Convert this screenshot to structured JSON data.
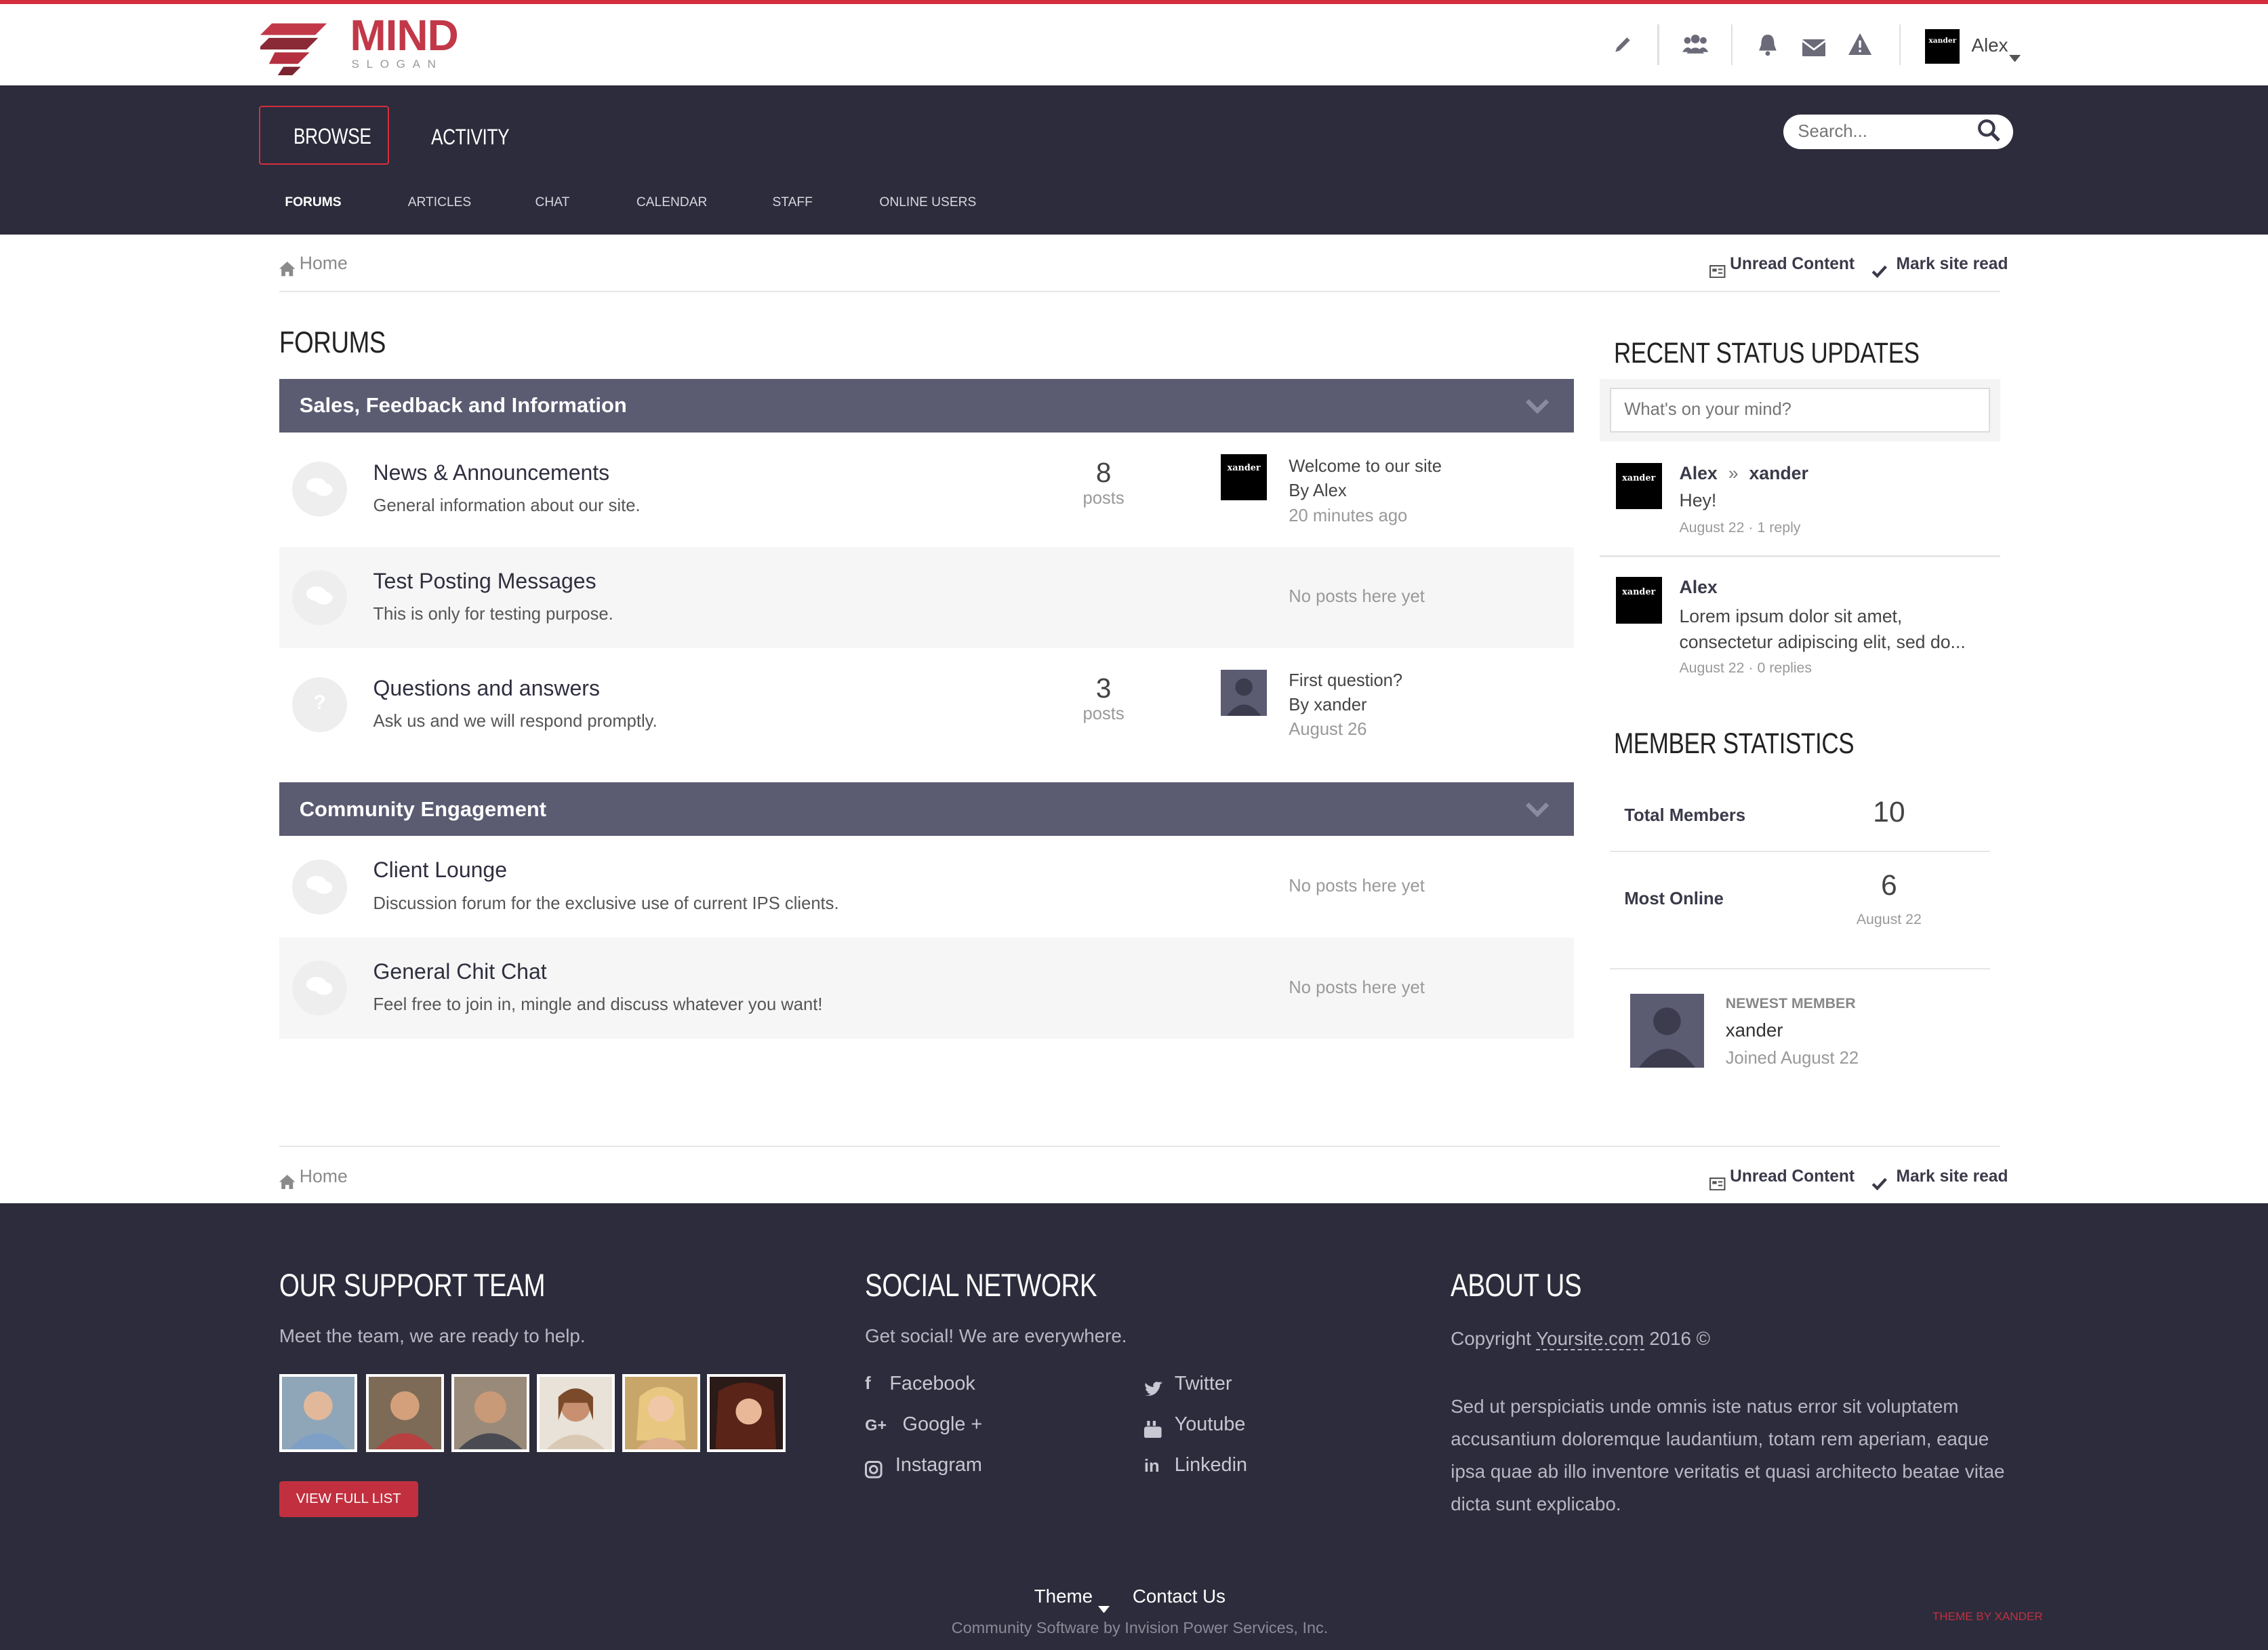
{
  "brand": {
    "name": "MIND",
    "slogan": "SLOGAN"
  },
  "user": {
    "name": "Alex"
  },
  "nav": {
    "primary": [
      {
        "label": "BROWSE"
      },
      {
        "label": "ACTIVITY"
      }
    ],
    "secondary": [
      {
        "label": "FORUMS"
      },
      {
        "label": "ARTICLES"
      },
      {
        "label": "CHAT"
      },
      {
        "label": "CALENDAR"
      },
      {
        "label": "STAFF"
      },
      {
        "label": "ONLINE USERS"
      }
    ]
  },
  "search": {
    "placeholder": "Search..."
  },
  "breadcrumb": {
    "home": "Home",
    "unread": "Unread Content",
    "mark_read": "Mark site read"
  },
  "forums": {
    "title": "FORUMS",
    "categories": [
      {
        "title": "Sales, Feedback and Information",
        "forums": [
          {
            "name": "News & Announcements",
            "desc": "General information about our site.",
            "count": "8",
            "count_label": "posts",
            "last_title": "Welcome to our site",
            "last_by": "By Alex",
            "last_time": "20 minutes ago"
          },
          {
            "name": "Test Posting Messages",
            "desc": "This is only for testing purpose.",
            "empty": "No posts here yet"
          },
          {
            "name": "Questions and answers",
            "desc": "Ask us and we will respond promptly.",
            "count": "3",
            "count_label": "posts",
            "last_title": "First question?",
            "last_by": "By xander",
            "last_time": "August 26"
          }
        ]
      },
      {
        "title": "Community Engagement",
        "forums": [
          {
            "name": "Client Lounge",
            "desc": "Discussion forum for the exclusive use of current IPS clients.",
            "empty": "No posts here yet"
          },
          {
            "name": "General Chit Chat",
            "desc": "Feel free to join in, mingle and discuss whatever you want!",
            "empty": "No posts here yet"
          }
        ]
      }
    ]
  },
  "status": {
    "title": "RECENT STATUS UPDATES",
    "placeholder": "What's on your mind?",
    "items": [
      {
        "author": "Alex",
        "sep": "»",
        "target": "xander",
        "text": "Hey!",
        "meta": "August 22 · 1 reply"
      },
      {
        "author": "Alex",
        "text": "Lorem ipsum dolor sit amet, consectetur adipiscing elit, sed do...",
        "meta": "August 22 · 0 replies"
      }
    ]
  },
  "stats": {
    "title": "MEMBER STATISTICS",
    "total_label": "Total Members",
    "total_value": "10",
    "online_label": "Most Online",
    "online_value": "6",
    "online_date": "August 22",
    "newest_label": "NEWEST MEMBER",
    "newest_name": "xander",
    "newest_joined": "Joined August 22"
  },
  "avatar_text": "xander",
  "footer": {
    "support": {
      "title": "OUR SUPPORT TEAM",
      "text": "Meet the team, we are ready to help.",
      "button": "VIEW FULL LIST"
    },
    "social": {
      "title": "SOCIAL NETWORK",
      "text": "Get social! We are everywhere.",
      "links": [
        {
          "label": "Facebook",
          "icon": "facebook-icon"
        },
        {
          "label": "Twitter",
          "icon": "twitter-icon"
        },
        {
          "label": "Google +",
          "icon": "google-plus-icon"
        },
        {
          "label": "Youtube",
          "icon": "youtube-icon"
        },
        {
          "label": "Instagram",
          "icon": "instagram-icon"
        },
        {
          "label": "Linkedin",
          "icon": "linkedin-icon"
        }
      ]
    },
    "about": {
      "title": "ABOUT US",
      "copyright_pre": "Copyright ",
      "copyright_link": "Yoursite.com",
      "copyright_post": " 2016 ©",
      "text": "Sed ut perspiciatis unde omnis iste natus error sit voluptatem accusantium doloremque laudantium, totam rem aperiam, eaque ipsa quae ab illo inventore veritatis et quasi architecto beatae vitae dicta sunt explicabo."
    },
    "bottom": {
      "theme": "Theme",
      "contact": "Contact Us",
      "powered": "Community Software by Invision Power Services, Inc.",
      "credit": "THEME BY XANDER"
    }
  },
  "colors": {
    "accent": "#d42e3e",
    "nav_bg": "#2c2c3c",
    "category_bg": "#5b5b72"
  }
}
